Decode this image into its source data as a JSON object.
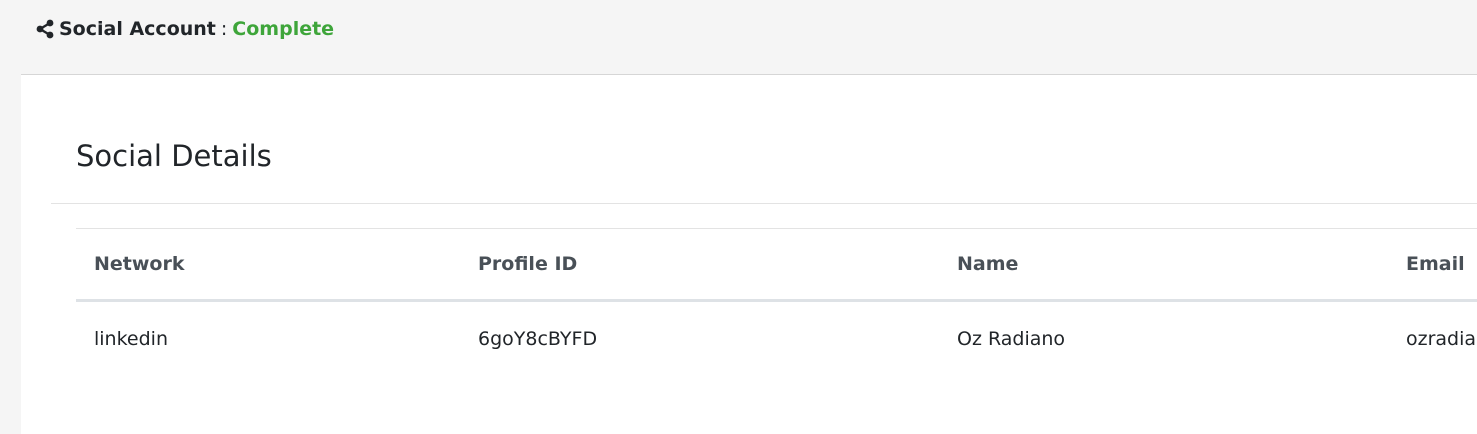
{
  "header": {
    "title": "Social Account",
    "separator": ":",
    "status": "Complete",
    "icon": "share-icon",
    "status_color": "#3ea53a"
  },
  "section": {
    "title": "Social Details"
  },
  "table": {
    "columns": [
      "Network",
      "Profile ID",
      "Name",
      "Email"
    ],
    "rows": [
      [
        "linkedin",
        "6goY8cBYFD",
        "Oz Radiano",
        "ozradia"
      ]
    ]
  }
}
